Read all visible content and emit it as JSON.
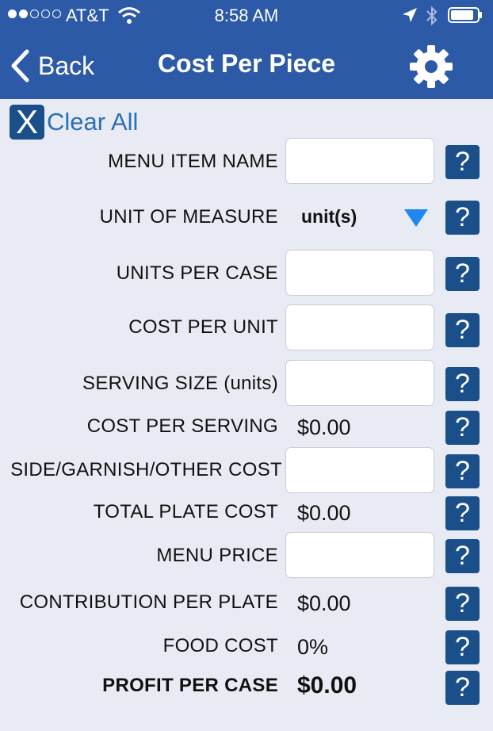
{
  "status_bar": {
    "carrier": "AT&T",
    "time": "8:58 AM",
    "signal_bars_filled": 2,
    "signal_bars_total": 5
  },
  "nav": {
    "back_label": "Back",
    "title": "Cost Per Piece"
  },
  "clear": {
    "icon_glyph": "X",
    "label": "Clear All"
  },
  "rows": {
    "menu_item_name": {
      "label": "MENU ITEM NAME",
      "value": ""
    },
    "unit_of_measure": {
      "label": "UNIT OF MEASURE",
      "value": "unit(s)"
    },
    "units_per_case": {
      "label": "UNITS PER CASE",
      "value": ""
    },
    "cost_per_unit": {
      "label": "COST PER UNIT",
      "value": ""
    },
    "serving_size": {
      "label": "SERVING SIZE (units)",
      "value": ""
    },
    "cost_per_serving": {
      "label": "COST PER SERVING",
      "value": "$0.00"
    },
    "side_garnish_other_cost": {
      "label": "SIDE/GARNISH/OTHER COST",
      "value": ""
    },
    "total_plate_cost": {
      "label": "TOTAL PLATE COST",
      "value": "$0.00"
    },
    "menu_price": {
      "label": "MENU PRICE",
      "value": ""
    },
    "contribution_per_plate": {
      "label": "CONTRIBUTION PER PLATE",
      "value": "$0.00"
    },
    "food_cost": {
      "label": "FOOD COST",
      "value": "0%"
    },
    "profit_per_case": {
      "label": "PROFIT PER CASE",
      "value": "$0.00"
    }
  },
  "help_glyph": "?",
  "colors": {
    "nav_background": "#2d5aa7",
    "page_background": "#e8ebf3",
    "help_button": "#1a4f8a",
    "link_blue": "#2b6fb5",
    "dropdown_arrow": "#1e88f0"
  }
}
